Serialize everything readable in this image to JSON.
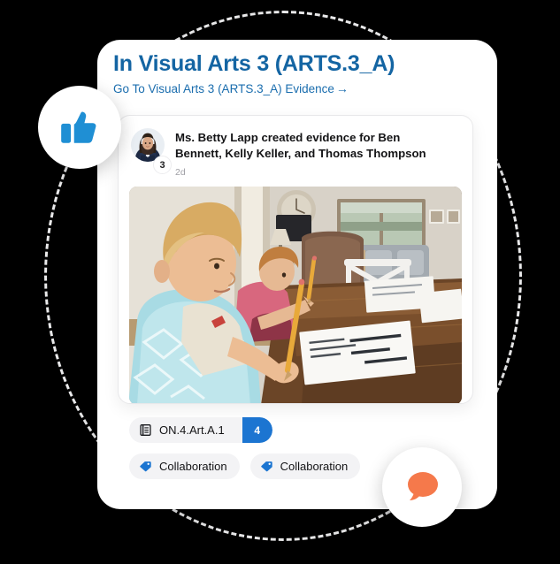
{
  "theme": {
    "background": "#000000",
    "card_bg": "#ffffff",
    "title_color": "#1465a3",
    "link_color": "#1a6dae",
    "accent_blue": "#1c75d1",
    "tag_icon_blue": "#1c75d1",
    "chip_bg": "#f3f3f5",
    "chat_orange": "#f5794b",
    "thumb_blue": "#1f8fd4",
    "dash_color": "#e9e9ea",
    "muted_text": "#a0a0a6"
  },
  "header": {
    "title": "In Visual Arts 3 (ARTS.3_A)",
    "link_label": "Go To Visual Arts 3 (ARTS.3_A) Evidence",
    "link_arrow": "→"
  },
  "post": {
    "avatar_badge": "3",
    "author_and_action": "Ms. Betty Lapp created evidence for Ben Bennett, Kelly Keller, and Thomas Thompson",
    "timestamp": "2d",
    "avatar_alt": "teacher-portrait",
    "photo_alt": "two-boys-doing-schoolwork-at-dining-table"
  },
  "chips": {
    "standard": {
      "icon": "book-icon",
      "label": "ON.4.Art.A.1",
      "count": "4"
    },
    "tags": [
      {
        "icon": "tag-icon",
        "label": "Collaboration"
      },
      {
        "icon": "tag-icon",
        "label": "Collaboration"
      }
    ]
  },
  "floating": {
    "like": {
      "icon": "thumbs-up-icon"
    },
    "chat": {
      "icon": "chat-bubble-icon"
    }
  }
}
